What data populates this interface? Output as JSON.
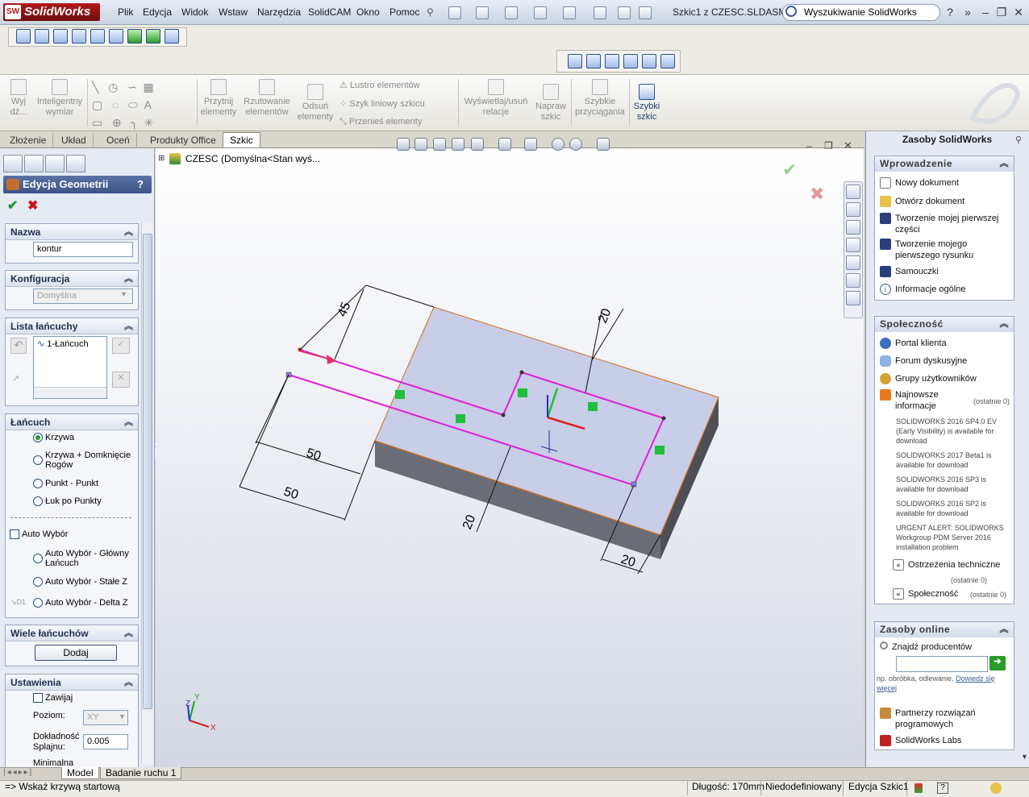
{
  "app": {
    "logo": "SolidWorks",
    "logo_badge": "SW",
    "doc_title": "Szkic1 z CZESC.SLDASM *"
  },
  "menu": [
    "Plik",
    "Edycja",
    "Widok",
    "Wstaw",
    "Narzędzia",
    "SolidCAM",
    "Okno",
    "Pomoc"
  ],
  "search": {
    "value": "Wyszukiwanie SolidWorks"
  },
  "window_controls": {
    "help": "?",
    "minimize": "–",
    "restore": "❐",
    "close": "✕"
  },
  "commands": {
    "exit": "Wyj\ndź...",
    "smart_dim": "Inteligentny\nwymiar",
    "trim": "Przytnij\nelementy",
    "convert": "Rzutowanie\nelementów",
    "offset": "Odsuń\nelementy",
    "mirror": "Lustro elementów",
    "pattern": "Szyk liniowy szkicu",
    "move": "Przenieś elementy",
    "relations": "Wyświetlaj/usuń\nrelacje",
    "repair": "Napraw\nszkic",
    "snaps": "Szybkie\nprzyciągania",
    "rapid": "Szybki\nszkic"
  },
  "tabs": [
    "Złożenie",
    "Układ",
    "Oceń",
    "Produkty Office",
    "Szkic"
  ],
  "property_manager": {
    "title": "Edycja Geometrii",
    "help": "?",
    "name_group": {
      "header": "Nazwa",
      "value": "kontur"
    },
    "config_group": {
      "header": "Konfiguracja",
      "value": "Domyślna"
    },
    "chain_list": {
      "header": "Lista łańcuchy",
      "item": "1-Łańcuch"
    },
    "chain_group": {
      "header": "Łańcuch",
      "options": [
        "Krzywa",
        "Krzywa + Domknięcie Rogów",
        "Punkt - Punkt",
        "Łuk po Punkty"
      ],
      "auto": "Auto Wybór",
      "auto_options": [
        "Auto Wybór - Główny Łańcuch",
        "Auto Wybór - Stałe Z",
        "Auto Wybór - Delta Z"
      ]
    },
    "multi_group": {
      "header": "Wiele łańcuchów",
      "button": "Dodaj"
    },
    "settings_group": {
      "header": "Ustawienia",
      "wrap": "Zawijaj",
      "level_label": "Poziom:",
      "level_value": "XY",
      "spline_label": "Dokładność Splajnu:",
      "spline_value": "0.005",
      "min_label": "Minimalna"
    }
  },
  "graphics": {
    "feature_path": "CZESC  (Domyślna<Stan wyś...",
    "dims": [
      "45",
      "20",
      "50",
      "50",
      "20",
      "20"
    ],
    "triad": {
      "x": "X",
      "y": "Y",
      "z": "Z"
    }
  },
  "task_pane": {
    "title": "Zasoby SolidWorks",
    "intro": {
      "header": "Wprowadzenie",
      "items": [
        "Nowy dokument",
        "Otwórz dokument",
        "Tworzenie mojej pierwszej części",
        "Tworzenie mojego pierwszego rysunku",
        "Samouczki",
        "Informacje ogólne"
      ]
    },
    "community": {
      "header": "Społeczność",
      "items": [
        "Portal klienta",
        "Forum dyskusyjne",
        "Grupy użytkowników",
        "Najnowsze informacje"
      ],
      "recent": "(ostatnie 0)",
      "news": [
        "SOLIDWORKS 2016 SP4.0 EV (Early Visibility) is available for download",
        "SOLIDWORKS 2017 Beta1 is available for download",
        "SOLIDWORKS 2016 SP3 is available for download",
        "SOLIDWORKS 2016 SP2 is available for download",
        "URGENT ALERT: SOLIDWORKS Workgroup PDM Server 2016 installation problem"
      ],
      "tech_alerts": "Ostrzeżenia techniczne",
      "tech_recent": "(ostatnie 0)",
      "community_link": "Społeczność",
      "community_recent": "(ostatnie 0)"
    },
    "online": {
      "header": "Zasoby online",
      "find": "Znajdź producentów",
      "hint": "np. obróbka, odlewanie.",
      "more": "Dowiedz się więcej",
      "partners": "Partnerzy rozwiązań programowych",
      "labs": "SolidWorks Labs"
    }
  },
  "bottom_tabs": [
    "Model",
    "Badanie ruchu 1"
  ],
  "status": {
    "hint": "=> Wskaż krzywą startową",
    "length": "Długość: 170mm",
    "defined": "Niedodefiniowany",
    "edit": "Edycja Szkic1",
    "help": "?"
  },
  "colors": {
    "sketch": "#e01fd8",
    "part_top": "#c9cde6",
    "part_side": "#6b6e78",
    "edge": "#d46d1b",
    "ok": "#1b9a2b",
    "cancel": "#c7151a"
  }
}
